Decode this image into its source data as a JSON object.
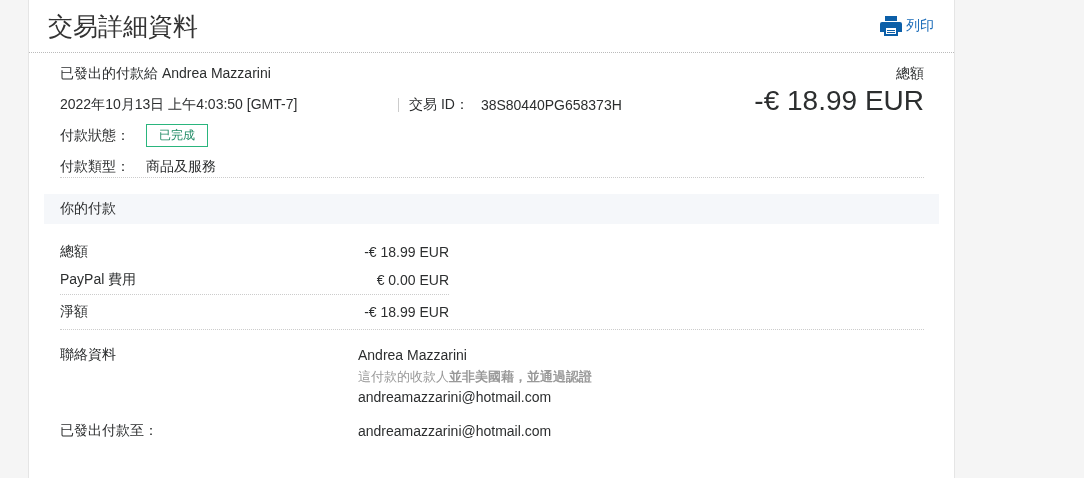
{
  "title": "交易詳細資料",
  "print_link": "列印",
  "summary": {
    "recipient_line": "已發出的付款給 Andrea Mazzarini",
    "datetime": "2022年10月13日 上午4:03:50 [GMT-7]",
    "transaction_id_label": "交易 ID：",
    "transaction_id": "38S80440PG658373H",
    "status_label": "付款狀態：",
    "status": "已完成",
    "type_label": "付款類型：",
    "type": "商品及服務",
    "total_label": "總額",
    "total": "-€ 18.99 EUR"
  },
  "section_title": "你的付款",
  "amounts": [
    {
      "label": "總額",
      "value": "-€ 18.99 EUR"
    },
    {
      "label": "PayPal 費用",
      "value": "€ 0.00 EUR"
    }
  ],
  "net": {
    "label": "淨額",
    "value": "-€ 18.99 EUR"
  },
  "contact": {
    "label": "聯絡資料",
    "name": "Andrea Mazzarini",
    "note": "這付款的收款人**並非美國藉，並通過認證**",
    "email": "andreamazzarini@hotmail.com"
  },
  "sent_to": {
    "label": "已發出付款至：",
    "value": "andreamazzarini@hotmail.com"
  }
}
